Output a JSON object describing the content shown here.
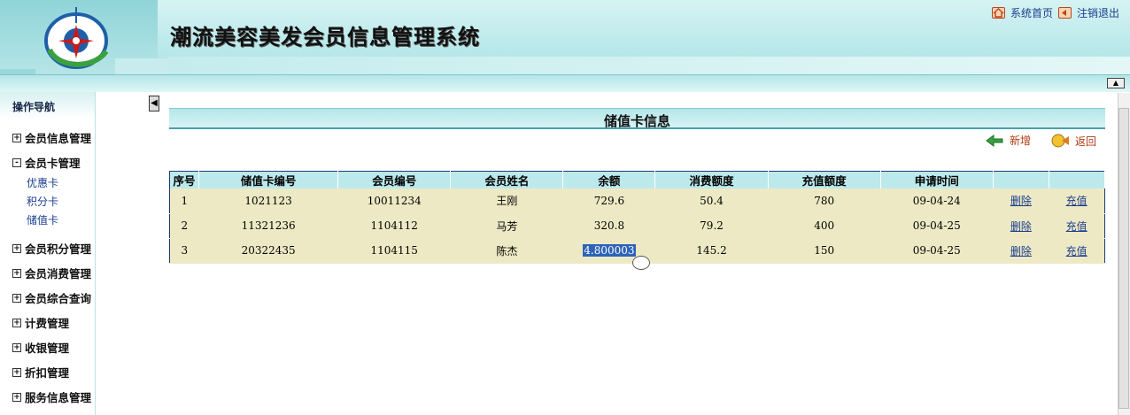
{
  "app": {
    "title": "潮流美容美发会员信息管理系统",
    "home_label": "系统首页",
    "logout_label": "注销退出"
  },
  "sidebar": {
    "header": "操作导航",
    "items": [
      {
        "label": "会员信息管理",
        "toggle": "+"
      },
      {
        "label": "会员卡管理",
        "toggle": "-"
      },
      {
        "label": "会员积分管理",
        "toggle": "+"
      },
      {
        "label": "会员消费管理",
        "toggle": "+"
      },
      {
        "label": "会员综合查询",
        "toggle": "+"
      },
      {
        "label": "计费管理",
        "toggle": "+"
      },
      {
        "label": "收银管理",
        "toggle": "+"
      },
      {
        "label": "折扣管理",
        "toggle": "+"
      },
      {
        "label": "服务信息管理",
        "toggle": "+"
      }
    ],
    "subitems": [
      "优惠卡",
      "积分卡",
      "储值卡"
    ]
  },
  "main": {
    "section_title": "储值卡信息",
    "add_label": "新增",
    "back_label": "返回",
    "table": {
      "headers": [
        "序号",
        "储值卡编号",
        "会员编号",
        "会员姓名",
        "余额",
        "消费额度",
        "充值额度",
        "申请时间",
        "",
        ""
      ],
      "rows": [
        {
          "no": "1",
          "card": "1021123",
          "member": "10011234",
          "name": "王刚",
          "balance": "729.6",
          "spent": "50.4",
          "recharge": "780",
          "date": "09-04-24",
          "del": "删除",
          "charge": "充值"
        },
        {
          "no": "2",
          "card": "11321236",
          "member": "1104112",
          "name": "马芳",
          "balance": "320.8",
          "spent": "79.2",
          "recharge": "400",
          "date": "09-04-25",
          "del": "删除",
          "charge": "充值"
        },
        {
          "no": "3",
          "card": "20322435",
          "member": "1104115",
          "name": "陈杰",
          "balance": "4.800003",
          "spent": "145.2",
          "recharge": "150",
          "date": "09-04-25",
          "del": "删除",
          "charge": "充值"
        }
      ]
    }
  },
  "colors": {
    "header_bg": "#b8e8ea",
    "table_header_bg": "#bce9ec",
    "table_row_bg": "#ede9c4",
    "link": "#1a3d8f",
    "action_text": "#b03a10",
    "selection": "#2d63b7"
  },
  "icons": [
    "logo",
    "home-icon",
    "exit-icon",
    "add-icon",
    "back-icon",
    "collapse-arrow-icon",
    "scroll-up-icon"
  ]
}
